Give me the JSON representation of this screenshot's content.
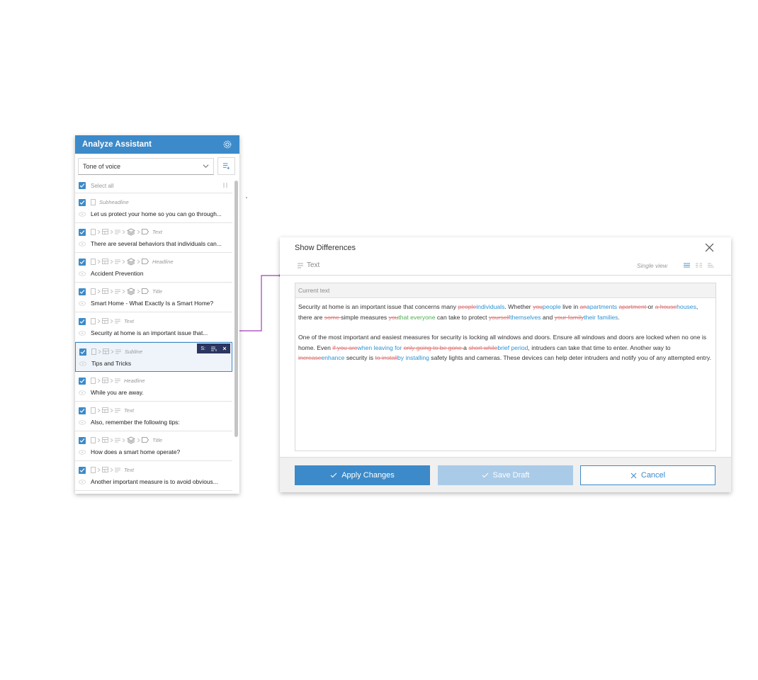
{
  "colors": {
    "accent": "#3c8ac9",
    "deleted": "#e07a7a",
    "inserted": "#2a93d5",
    "green": "#4caf50",
    "connector": "#a13fbd"
  },
  "assistant": {
    "title": "Analyze Assistant",
    "dropdown_value": "Tone of voice",
    "select_all": "Select all",
    "items": [
      {
        "type": "Subheadline",
        "text": "Let us protect your home so you can go through..."
      },
      {
        "type": "Text",
        "text": "There are several behaviors that individuals can..."
      },
      {
        "type": "Headline",
        "text": "Accident Prevention"
      },
      {
        "type": "Title",
        "text": "Smart Home - What Exactly Is a Smart Home?"
      },
      {
        "type": "Text",
        "text": "Security at home is an important issue that..."
      },
      {
        "type": "Subline",
        "text": "Tips and Tricks",
        "toolbar": "S:"
      },
      {
        "type": "Headline",
        "text": "While you are away."
      },
      {
        "type": "Text",
        "text": "Also, remember the following tips:"
      },
      {
        "type": "Title",
        "text": "How does a smart home operate?"
      },
      {
        "type": "Text",
        "text": "Another important measure is to avoid obvious..."
      }
    ]
  },
  "diff": {
    "title": "Show Differences",
    "sub_label": "Text",
    "view_label": "Single view",
    "box_header": "Current text",
    "p1": [
      [
        "Security at home is an important issue that concerns many ",
        ""
      ],
      [
        "people",
        "del"
      ],
      [
        "individuals",
        "ins"
      ],
      [
        ". Whether ",
        ""
      ],
      [
        "you",
        "del"
      ],
      [
        "people",
        "ins"
      ],
      [
        " live in ",
        ""
      ],
      [
        "an",
        "del"
      ],
      [
        "apartments",
        "ins"
      ],
      [
        " ",
        ""
      ],
      [
        "apartment ",
        "del"
      ],
      [
        "or ",
        ""
      ],
      [
        "a house",
        "del"
      ],
      [
        "houses",
        "ins"
      ],
      [
        ", there are ",
        ""
      ],
      [
        "some ",
        "del"
      ],
      [
        "simple measures ",
        ""
      ],
      [
        "you",
        "del"
      ],
      [
        "that everyone",
        "grn"
      ],
      [
        " can take to protect ",
        ""
      ],
      [
        "yourself",
        "del"
      ],
      [
        "themselves",
        "ins"
      ],
      [
        " and ",
        ""
      ],
      [
        "your family",
        "del"
      ],
      [
        "their families",
        "ins"
      ],
      [
        ".",
        ""
      ]
    ],
    "p2": [
      [
        "One of the most important and easiest measures for security is locking all windows and doors. Ensure all windows and doors are locked when no one is home. Even ",
        ""
      ],
      [
        "if you are",
        "del"
      ],
      [
        "when leaving for",
        "ins"
      ],
      [
        " ",
        ""
      ],
      [
        "only going to be gone ",
        "del"
      ],
      [
        "a ",
        ""
      ],
      [
        "short while",
        "del"
      ],
      [
        "brief period",
        "ins"
      ],
      [
        ", intruders can take that time to enter. Another way to ",
        ""
      ],
      [
        "increase",
        "del"
      ],
      [
        "enhance",
        "ins"
      ],
      [
        " security is ",
        ""
      ],
      [
        "to install",
        "del"
      ],
      [
        "by installing",
        "ins"
      ],
      [
        " safety lights and cameras. These devices can help deter intruders and notify you of any attempted entry.",
        ""
      ]
    ],
    "buttons": {
      "apply": "Apply Changes",
      "draft": "Save Draft",
      "cancel": "Cancel"
    }
  }
}
